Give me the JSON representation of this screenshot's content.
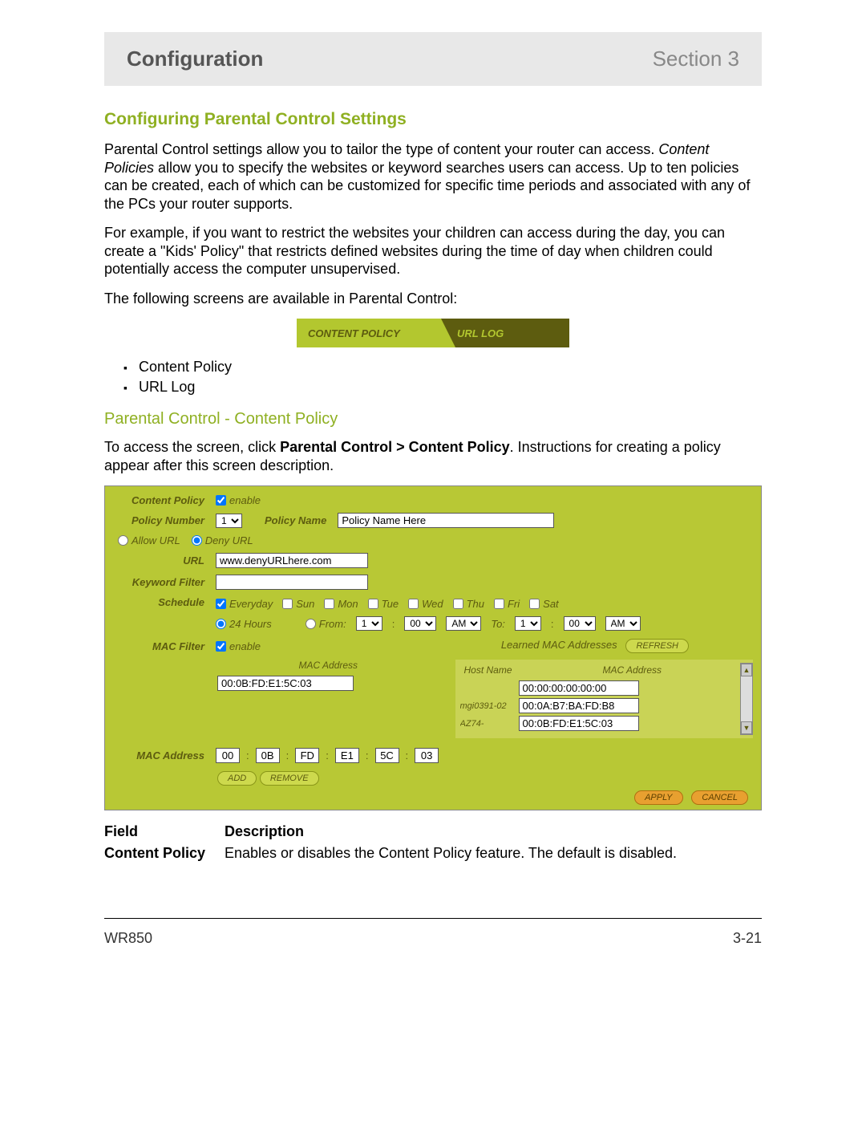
{
  "header": {
    "left": "Configuration",
    "right": "Section 3"
  },
  "section_heading": "Configuring Parental Control Settings",
  "para1a": "Parental Control settings allow you to tailor the type of content your router can access. ",
  "para1b": "Content Policies",
  "para1c": " allow you to specify the websites or keyword searches users can access. Up to ten policies can be created, each of which can be customized for specific time periods and associated with any of the PCs your router supports.",
  "para2": "For example, if you want to restrict the websites your children can access during the day, you can create a \"Kids' Policy\" that restricts defined websites during the time of day when children could potentially access the computer unsupervised.",
  "para3": "The following screens are available in Parental Control:",
  "tabs": {
    "active": "CONTENT POLICY",
    "inactive": "URL LOG"
  },
  "bullets": [
    "Content Policy",
    "URL Log"
  ],
  "sub_heading": "Parental Control - Content Policy",
  "para4a": "To access the screen, click ",
  "para4b": "Parental Control > Content Policy",
  "para4c": ". Instructions for creating a policy appear after this screen description.",
  "panel": {
    "labels": {
      "content_policy": "Content Policy",
      "enable": "enable",
      "policy_number": "Policy Number",
      "policy_name": "Policy Name",
      "allow_url": "Allow URL",
      "deny_url": "Deny URL",
      "url": "URL",
      "keyword_filter": "Keyword Filter",
      "schedule": "Schedule",
      "everyday": "Everyday",
      "sun": "Sun",
      "mon": "Mon",
      "tue": "Tue",
      "wed": "Wed",
      "thu": "Thu",
      "fri": "Fri",
      "sat": "Sat",
      "h24": "24 Hours",
      "from": "From:",
      "to": "To:",
      "mac_filter": "MAC Filter",
      "learned": "Learned MAC Addresses",
      "refresh": "REFRESH",
      "mac_address": "MAC Address",
      "host_name": "Host Name",
      "add": "ADD",
      "remove": "REMOVE",
      "apply": "APPLY",
      "cancel": "CANCEL"
    },
    "policy_number": "1",
    "policy_name_value": "Policy Name Here",
    "url_value": "www.denyURLhere.com",
    "keyword_value": "",
    "from_h": "1",
    "from_m": "00",
    "from_ap": "AM",
    "to_h": "1",
    "to_m": "00",
    "to_ap": "AM",
    "mac_left_value": "00:0B:FD:E1:5C:03",
    "learned": [
      {
        "host": "",
        "mac": "00:00:00:00:00:00"
      },
      {
        "host": "mgi0391-02",
        "mac": "00:0A:B7:BA:FD:B8"
      },
      {
        "host": "AZ74-",
        "mac": "00:0B:FD:E1:5C:03"
      }
    ],
    "oct": [
      "00",
      "0B",
      "FD",
      "E1",
      "5C",
      "03"
    ]
  },
  "table": {
    "h_field": "Field",
    "h_desc": "Description",
    "r1_field": "Content Policy",
    "r1_desc": "Enables or disables the Content Policy feature. The default is disabled."
  },
  "footer": {
    "left": "WR850",
    "right": "3-21"
  }
}
